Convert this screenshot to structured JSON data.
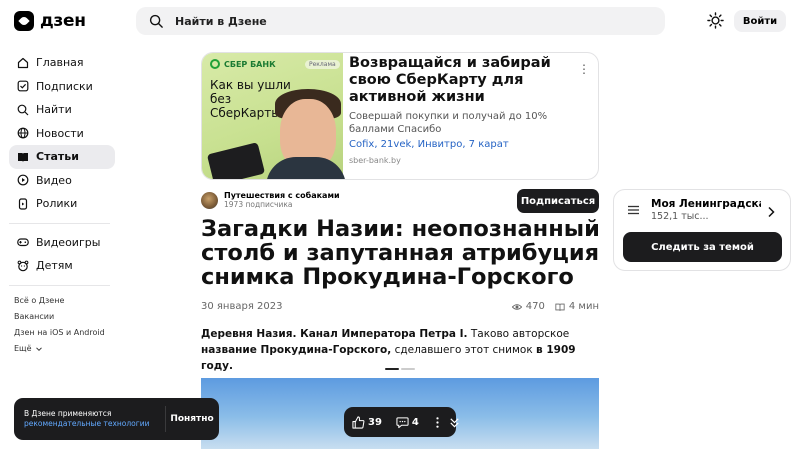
{
  "header": {
    "logo_text": "дзен",
    "search_placeholder": "Найти в Дзене",
    "login_label": "Войти"
  },
  "sidebar": {
    "items": [
      {
        "label": "Главная",
        "icon": "home-icon"
      },
      {
        "label": "Подписки",
        "icon": "subscriptions-icon"
      },
      {
        "label": "Найти",
        "icon": "search-icon"
      },
      {
        "label": "Новости",
        "icon": "news-icon"
      },
      {
        "label": "Статьи",
        "icon": "articles-icon",
        "active": true
      },
      {
        "label": "Видео",
        "icon": "video-icon"
      },
      {
        "label": "Ролики",
        "icon": "shorts-icon"
      }
    ],
    "items2": [
      {
        "label": "Видеоигры",
        "icon": "gamepad-icon"
      },
      {
        "label": "Детям",
        "icon": "kids-icon"
      }
    ],
    "links": [
      "Всё о Дзене",
      "Вакансии",
      "Дзен на iOS и Android",
      "Ещё"
    ]
  },
  "ad": {
    "brand": "СБЕР БАНК",
    "tag": "Реклама",
    "image_title": "Как вы ушли без СберКарты",
    "title": "Возвращайся и забирай свою СберКарту для активной жизни",
    "description": "Совершай покупки и получай до 10% баллами Спасибо",
    "links": "Cofix, 21vek, Инвитро, 7 карат",
    "domain": "sber-bank.by"
  },
  "channel": {
    "name": "Путешествия с собаками",
    "subscribers": "1973 подписчика",
    "subscribe_label": "Подписаться"
  },
  "article": {
    "title": "Загадки Назии: неопознанный столб и запутанная атрибуция снимка Прокудина-Горского",
    "date": "30 января 2023",
    "views": "470",
    "read_time": "4 мин",
    "lead": {
      "p1": "Деревня Назия. Канал Императора Петра I.",
      "p2": " Таково авторское ",
      "p3": "название Прокудина-Горского,",
      "p4": " сделавшего этот снимок ",
      "p5": "в 1909 году."
    }
  },
  "topic": {
    "name": "Моя Ленинградская...",
    "count": "152,1 тыс...",
    "follow_label": "Следить за темой"
  },
  "toast": {
    "text": "В Дзене применяются",
    "link": "рекомендательные технологии",
    "button": "Понятно"
  },
  "float_bar": {
    "likes": "39",
    "comments": "4"
  }
}
